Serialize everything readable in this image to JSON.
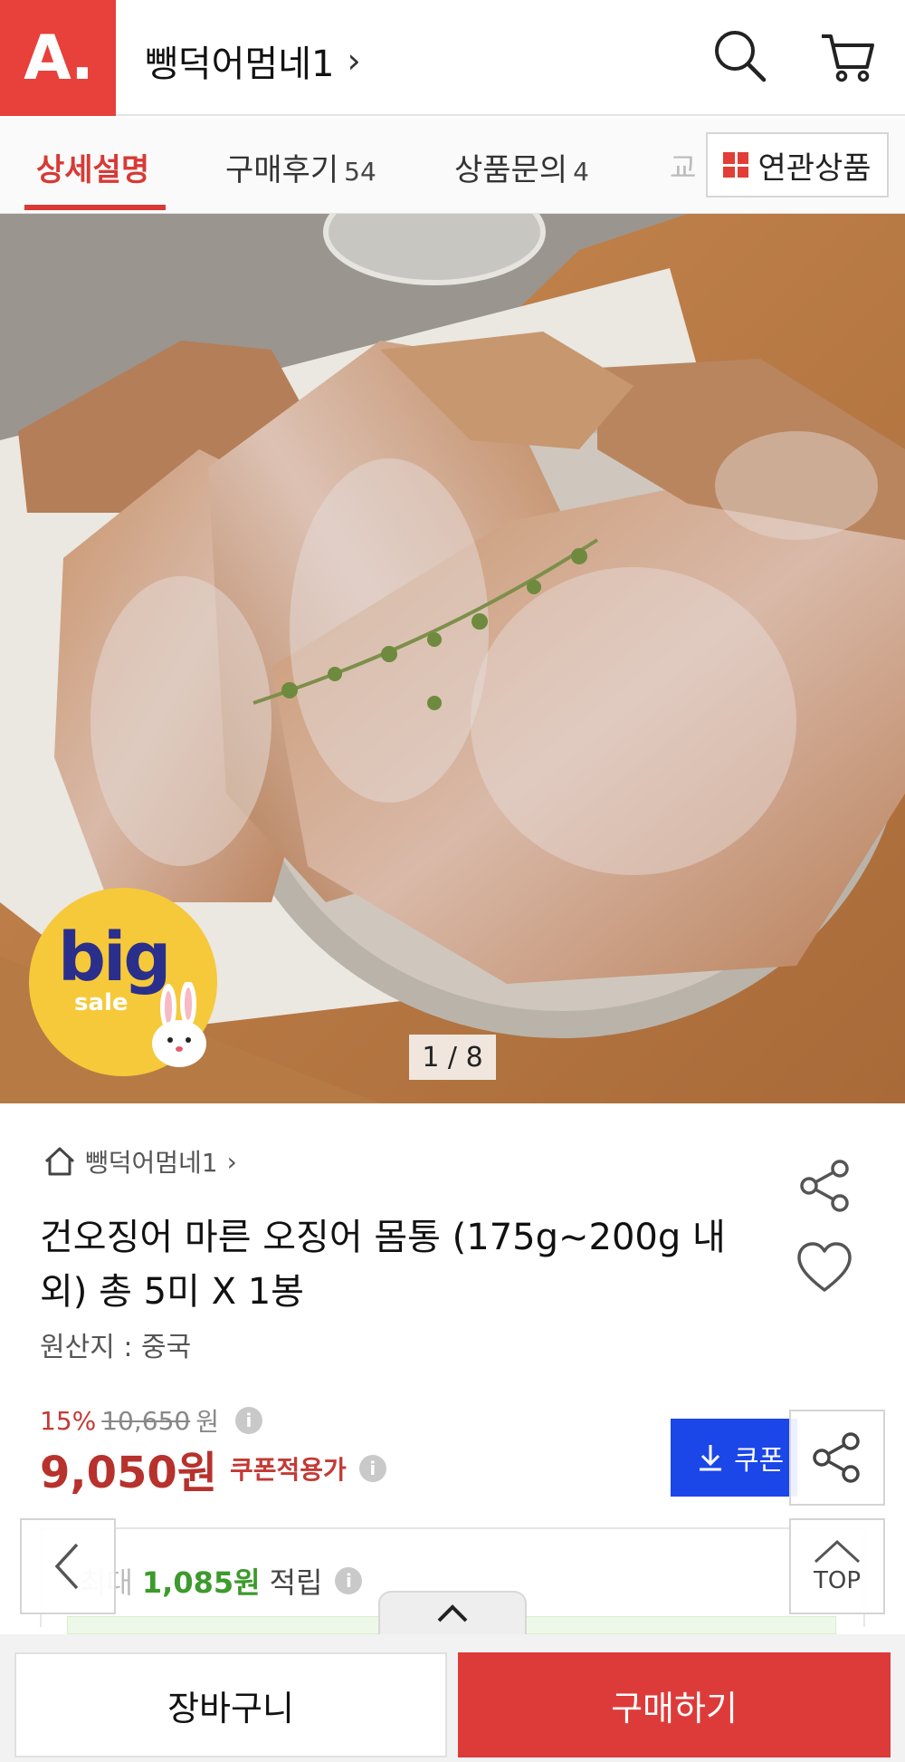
{
  "header": {
    "logo_text": "A.",
    "shop_name": "뺑덕어멈네1",
    "chevron": "›",
    "icons": [
      "search-icon",
      "cart-icon"
    ],
    "brand_color": "#e8403a"
  },
  "tabs": {
    "items": [
      {
        "label": "상세설명",
        "count": ""
      },
      {
        "label": "구매후기",
        "count": "54"
      },
      {
        "label": "상품문의",
        "count": "4"
      }
    ],
    "more_text": "교",
    "related_label": "연관상품",
    "active_color": "#d83a35"
  },
  "image": {
    "counter": "1 / 8",
    "badge_big": "big",
    "badge_sale": "sale"
  },
  "product": {
    "shop_crumb": "뺑덕어멈네1",
    "crumb_chevron": "›",
    "title": "건오징어 마른 오징어 몸통 (175g~200g 내외) 총 5미 X 1봉",
    "origin": "원산지 : 중국",
    "discount_pct": "15%",
    "original_price": "10,650",
    "original_unit": "원",
    "price": "9,050원",
    "price_label": "쿠폰적용가",
    "coupon_button": "쿠폰",
    "points_prefix": "최대",
    "points_amount": "1,085원",
    "points_suffix": "적립",
    "info_glyph": "i"
  },
  "floating": {
    "top_label": "TOP"
  },
  "bottom": {
    "cart_label": "장바구니",
    "buy_label": "구매하기",
    "buy_color": "#dd3b39"
  }
}
